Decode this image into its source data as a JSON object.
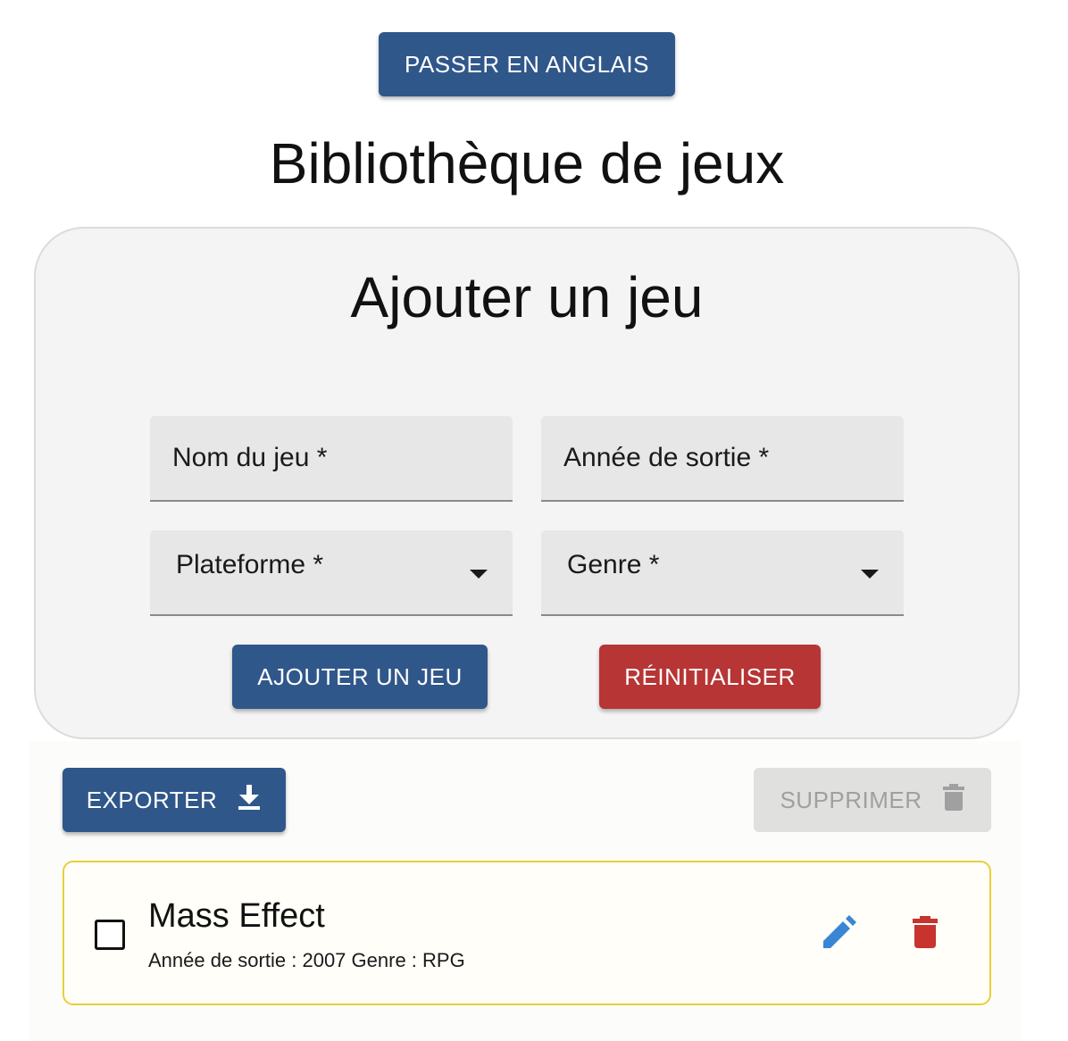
{
  "header": {
    "language_button": "PASSER EN ANGLAIS",
    "title": "Bibliothèque de jeux"
  },
  "form": {
    "title": "Ajouter un jeu",
    "name_label": "Nom du jeu *",
    "year_label": "Année de sortie *",
    "platform_label": "Plateforme *",
    "genre_label": "Genre *",
    "add_button": "AJOUTER UN JEU",
    "reset_button": "RÉINITIALISER"
  },
  "toolbar": {
    "export_button": "EXPORTER",
    "delete_selected_button": "SUPPRIMER"
  },
  "games": [
    {
      "title": "Mass Effect",
      "year_label": "Année de sortie :",
      "year": "2007",
      "genre_label": "Genre :",
      "genre": "RPG",
      "checked": false
    }
  ],
  "colors": {
    "primary": "#30578a",
    "danger": "#b73535",
    "disabled_bg": "#e0e1df",
    "disabled_text": "#9fa09f",
    "card_border": "#e8cf3a",
    "edit_icon": "#3a86d4",
    "delete_icon": "#c8332e"
  },
  "icons": {
    "export": "download-icon",
    "delete_selected": "trash-icon",
    "edit": "pencil-icon",
    "delete": "trash-icon",
    "select_caret": "caret-down-icon"
  }
}
